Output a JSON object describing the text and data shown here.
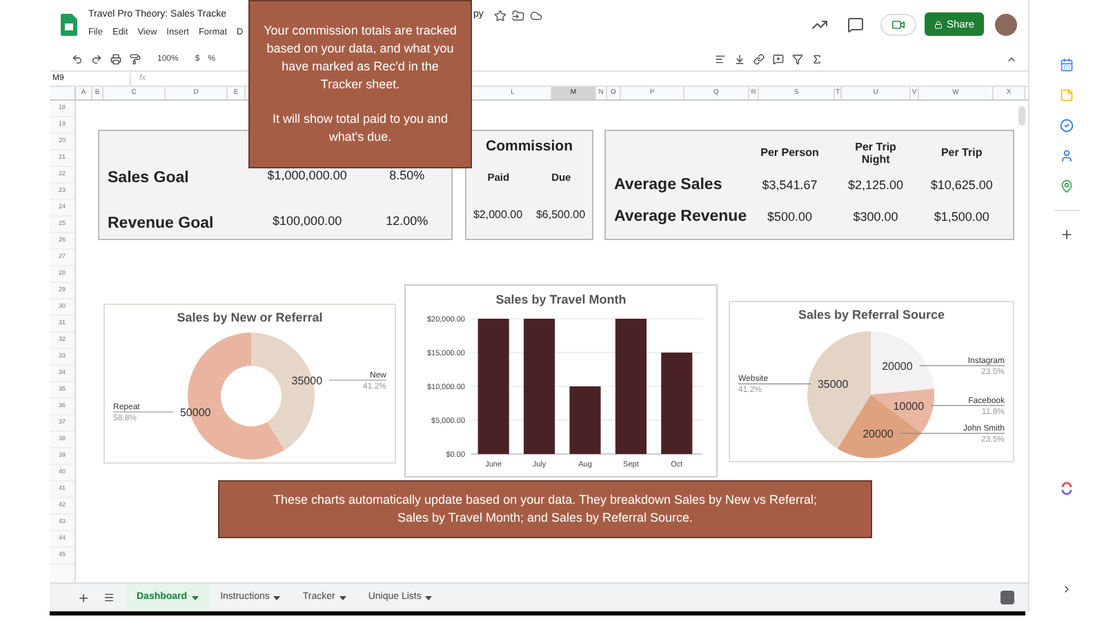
{
  "header": {
    "title": "Travel Pro Theory: Sales Tracke",
    "title_tail": "py",
    "menu": [
      "File",
      "Edit",
      "View",
      "Insert",
      "Format",
      "D"
    ],
    "share": "Share"
  },
  "toolbar": {
    "zoom": "100%",
    "currency": "$",
    "percent": "%"
  },
  "formula_bar": {
    "cell": "M9",
    "fx": "fx"
  },
  "columns": [
    {
      "label": "A",
      "selected": false
    },
    {
      "label": "B",
      "selected": false
    },
    {
      "label": "C",
      "selected": false
    },
    {
      "label": "D",
      "selected": false
    },
    {
      "label": "E",
      "selected": false
    },
    {
      "label": "L",
      "selected": false
    },
    {
      "label": "M",
      "selected": true
    },
    {
      "label": "N",
      "selected": false
    },
    {
      "label": "O",
      "selected": false
    },
    {
      "label": "P",
      "selected": false
    },
    {
      "label": "Q",
      "selected": false
    },
    {
      "label": "R",
      "selected": false
    },
    {
      "label": "S",
      "selected": false
    },
    {
      "label": "T",
      "selected": false
    },
    {
      "label": "U",
      "selected": false
    },
    {
      "label": "V",
      "selected": false
    },
    {
      "label": "W",
      "selected": false
    },
    {
      "label": "X",
      "selected": false
    }
  ],
  "row_numbers": [
    "18",
    "19",
    "20",
    "21",
    "22",
    "23",
    "24",
    "25",
    "26",
    "27",
    "28",
    "29",
    "30",
    "31",
    "32",
    "33",
    "34",
    "35",
    "36",
    "37",
    "38",
    "39",
    "40",
    "41",
    "42",
    "43",
    "44",
    "45"
  ],
  "goals": [
    {
      "label": "Sales Goal",
      "amount": "$1,000,000.00",
      "rate": "8.50%"
    },
    {
      "label": "Revenue Goal",
      "amount": "$100,000.00",
      "rate": "12.00%"
    }
  ],
  "commission": {
    "title": "Commission",
    "columns": [
      "Paid",
      "Due"
    ],
    "values": [
      "$2,000.00",
      "$6,500.00"
    ]
  },
  "averages": {
    "columns": [
      "Per Person",
      "Per Trip Night",
      "Per Trip"
    ],
    "rows": [
      {
        "label": "Average Sales",
        "values": [
          "$3,541.67",
          "$2,125.00",
          "$10,625.00"
        ]
      },
      {
        "label": "Average Revenue",
        "values": [
          "$500.00",
          "$300.00",
          "$1,500.00"
        ]
      }
    ]
  },
  "donut_chart": {
    "chart_data": {
      "type": "donut",
      "title": "Sales by New or Referral",
      "categories": [
        "New",
        "Repeat"
      ],
      "values": [
        35000,
        50000
      ],
      "data_labels": true,
      "colors": [
        "#e6d6c7",
        "#e9b5a0"
      ]
    },
    "percents": [
      "41.2%",
      "58.8%"
    ]
  },
  "bar_chart": {
    "chart_data": {
      "type": "bar",
      "title": "Sales by Travel Month",
      "categories": [
        "June",
        "July",
        "Aug",
        "Sept",
        "Oct"
      ],
      "values": [
        20000,
        20000,
        10000,
        20000,
        15000
      ],
      "color": "#4a2226",
      "grid": true,
      "ylim": [
        0,
        20000
      ],
      "yticks": [
        {
          "value": 0,
          "label": "$0.00"
        },
        {
          "value": 5000,
          "label": "$5,000.00"
        },
        {
          "value": 10000,
          "label": "$10,000.00"
        },
        {
          "value": 15000,
          "label": "$15,000.00"
        },
        {
          "value": 20000,
          "label": "$20,000.00"
        }
      ]
    }
  },
  "pie_chart": {
    "chart_data": {
      "type": "pie",
      "title": "Sales by Referral Source",
      "categories": [
        "Instagram",
        "Facebook",
        "John Smith",
        "Website"
      ],
      "values": [
        20000,
        10000,
        20000,
        35000
      ],
      "data_labels": true,
      "colors": [
        "#f3f1f2",
        "#e9b6a2",
        "#dfa27e",
        "#e4d4c6"
      ]
    },
    "percents": [
      "23.5%",
      "11.8%",
      "23.5%",
      "41.2%"
    ]
  },
  "callouts": [
    {
      "paragraphs": [
        "Your commission totals are tracked based on your data, and what you have marked as Rec'd in the Tracker sheet.",
        "It will show total paid to you and what's due."
      ]
    },
    {
      "paragraphs": [
        "These charts automatically update based on your data.  They breakdown Sales by New vs Referral; Sales by Travel Month; and Sales by Referral Source."
      ]
    }
  ],
  "sheet_tabs": [
    {
      "label": "Dashboard",
      "selected": true
    },
    {
      "label": "Instructions",
      "selected": false
    },
    {
      "label": "Tracker",
      "selected": false
    },
    {
      "label": "Unique Lists",
      "selected": false
    }
  ]
}
